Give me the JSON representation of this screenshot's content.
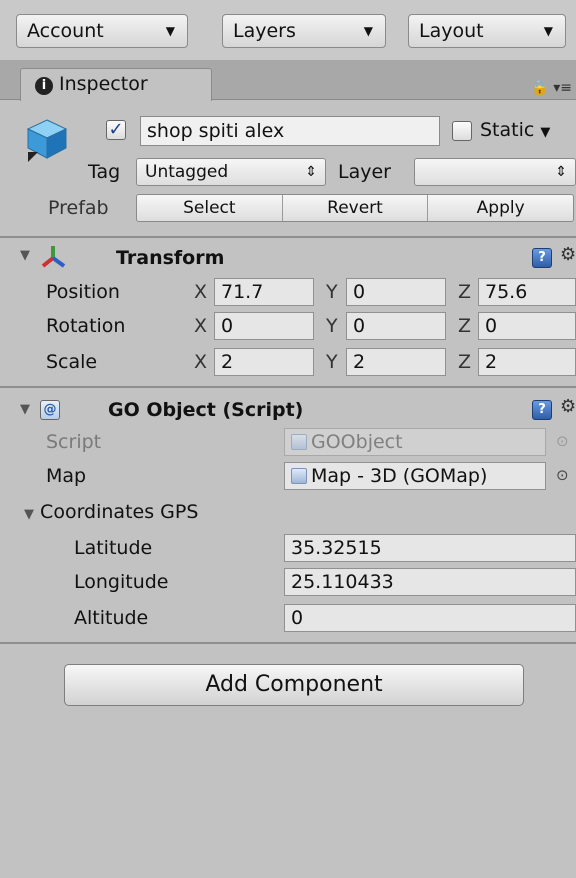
{
  "toolbar": {
    "account": "Account",
    "layers": "Layers",
    "layout": "Layout"
  },
  "tab": {
    "label": "Inspector"
  },
  "gameobject": {
    "name": "shop spiti alex",
    "active": true,
    "static_label": "Static",
    "static": false,
    "tag_label": "Tag",
    "tag_value": "Untagged",
    "layer_label": "Layer",
    "layer_value": "",
    "prefab_label": "Prefab",
    "prefab_buttons": [
      "Select",
      "Revert",
      "Apply"
    ]
  },
  "transform": {
    "title": "Transform",
    "rows": [
      {
        "label": "Position",
        "x": "71.7",
        "y": "0",
        "z": "75.6"
      },
      {
        "label": "Rotation",
        "x": "0",
        "y": "0",
        "z": "0"
      },
      {
        "label": "Scale",
        "x": "2",
        "y": "2",
        "z": "2"
      }
    ],
    "axes": [
      "X",
      "Y",
      "Z"
    ]
  },
  "goobject": {
    "title": "GO Object (Script)",
    "script_label": "Script",
    "script_value": "GOObject",
    "map_label": "Map",
    "map_value": "Map - 3D (GOMap)",
    "coords_label": "Coordinates GPS",
    "latitude_label": "Latitude",
    "latitude_value": "35.32515",
    "longitude_label": "Longitude",
    "longitude_value": "25.110433",
    "altitude_label": "Altitude",
    "altitude_value": "0"
  },
  "add_component": "Add Component",
  "colors": {
    "panel_bg": "#c2c2c2",
    "toolbar_bg": "#c9c9c9",
    "field_bg": "#e6e6e6",
    "check_color": "#1a3d8f"
  }
}
